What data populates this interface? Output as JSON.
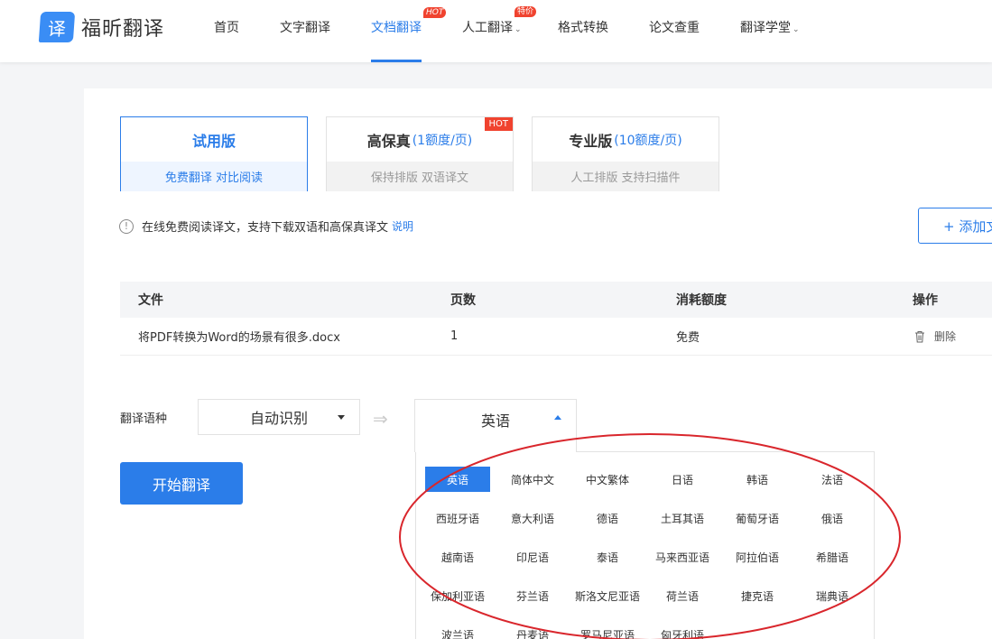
{
  "header": {
    "logo_mark": "译",
    "logo_text": "福昕翻译",
    "nav": [
      {
        "label": "首页"
      },
      {
        "label": "文字翻译"
      },
      {
        "label": "文档翻译",
        "badge": "HOT"
      },
      {
        "label": "人工翻译",
        "badge": "特价",
        "caret": "⌄"
      },
      {
        "label": "格式转换"
      },
      {
        "label": "论文查重"
      },
      {
        "label": "翻译学堂",
        "caret": "⌄"
      }
    ]
  },
  "versions": [
    {
      "title": "试用版",
      "price": "",
      "sub": "免费翻译  对比阅读"
    },
    {
      "title": "高保真",
      "price": "(1额度/页)",
      "sub": "保持排版  双语译文",
      "tag": "HOT"
    },
    {
      "title": "专业版",
      "price": "(10额度/页)",
      "sub": "人工排版  支持扫描件"
    }
  ],
  "notice": {
    "icon": "!",
    "text": "在线免费阅读译文，支持下载双语和高保真译文",
    "link": "说明"
  },
  "add_button": "+ 添加文件",
  "table": {
    "headers": [
      "文件",
      "页数",
      "消耗额度",
      "操作"
    ],
    "rows": [
      {
        "file": "将PDF转换为Word的场景有很多.docx",
        "pages": "1",
        "cost": "免费",
        "action": "删除"
      }
    ]
  },
  "language": {
    "label": "翻译语种",
    "source": "自动识别",
    "swap_icon": "⇒",
    "target": "英语",
    "options": [
      "英语",
      "简体中文",
      "中文繁体",
      "日语",
      "韩语",
      "法语",
      "西班牙语",
      "意大利语",
      "德语",
      "土耳其语",
      "葡萄牙语",
      "俄语",
      "越南语",
      "印尼语",
      "泰语",
      "马来西亚语",
      "阿拉伯语",
      "希腊语",
      "保加利亚语",
      "芬兰语",
      "斯洛文尼亚语",
      "荷兰语",
      "捷克语",
      "瑞典语",
      "波兰语",
      "丹麦语",
      "罗马尼亚语",
      "匈牙利语"
    ],
    "selected_option": "英语"
  },
  "start_button": "开始翻译",
  "colors": {
    "accent": "#2b7de9",
    "hot": "#f0432f",
    "annotation": "#d9262c"
  }
}
